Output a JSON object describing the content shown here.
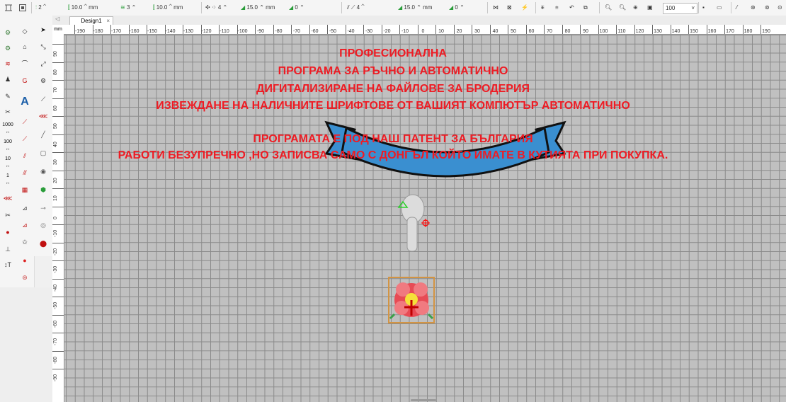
{
  "toolbar": {
    "field1": "2",
    "field2": "10.0",
    "unit_mm": "mm",
    "field3": "3",
    "field4": "10.0",
    "field5": "4",
    "field6": "15.0",
    "field7": "0",
    "field8": "4",
    "field9": "15.0",
    "field10": "0",
    "zoom": "100"
  },
  "tab": {
    "label": "Design1",
    "close": "×",
    "arrow": "◁"
  },
  "ruler": {
    "unit": "mm",
    "h_labels": [
      "-190",
      "-180",
      "-170",
      "-160",
      "-150",
      "-140",
      "-130",
      "-120",
      "-110",
      "-100",
      "-90",
      "-80",
      "-70",
      "-60",
      "-50",
      "-40",
      "-30",
      "-20",
      "-10",
      "0",
      "10",
      "20",
      "30",
      "40",
      "50",
      "60",
      "70",
      "80",
      "90",
      "100",
      "110",
      "120",
      "130",
      "140",
      "150",
      "160",
      "170",
      "180",
      "190"
    ],
    "v_labels": [
      "90",
      "80",
      "70",
      "60",
      "50",
      "40",
      "30",
      "20",
      "10",
      "0",
      "-10",
      "-20",
      "-30",
      "-40",
      "-50",
      "-60",
      "-70",
      "-80",
      "-90"
    ]
  },
  "overlay": {
    "line1": "ПРОФЕСИОНАЛНА",
    "line2": "ПРОГРАМА ЗА РЪЧНО И АВТОМАТИЧНО",
    "line3": "ДИГИТАЛИЗИРАНЕ НА ФАЙЛОВЕ ЗА БРОДЕРИЯ",
    "line4": "ИЗВЕЖДАНЕ НА НАЛИЧНИТЕ ШРИФТОВЕ ОТ ВАШИЯТ КОМПЮТЪР АВТОМАТИЧНО",
    "line5": "ПРОГРАМАТА Е ПОД НАШ ПАТЕНТ ЗА БЪЛГАРИЯ",
    "line6": "РАБОТИ БЕЗУПРЕЧНО ,НО ЗАПИСВА САМО С ДОНГЪЛ КОЙТО ИМАТЕ В КУТИЯТА ПРИ ПОКУПКА."
  },
  "left_tool_labels": {
    "t1000": "1000",
    "t100": "100",
    "t10": "10",
    "t1": "1",
    "text_tool": "A"
  },
  "colors": {
    "overlay_text": "#ee1c24",
    "banner": "#3a8fd0",
    "canvas": "#c0c0c0",
    "grid": "#8a8a8a"
  }
}
